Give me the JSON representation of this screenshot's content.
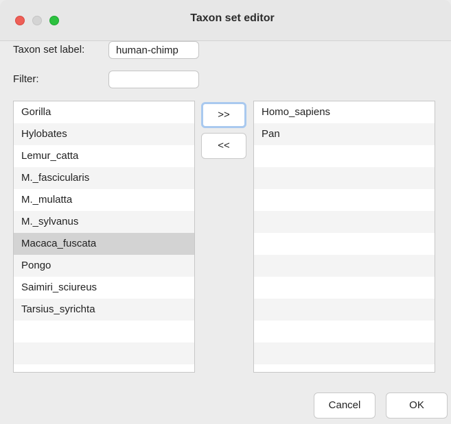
{
  "window": {
    "title": "Taxon set editor"
  },
  "form": {
    "taxon_set_label": "Taxon set label:",
    "taxon_set_value": "human-chimp",
    "filter_label": "Filter:",
    "filter_value": ""
  },
  "available_list": {
    "items": [
      "Gorilla",
      "Hylobates",
      "Lemur_catta",
      "M._fascicularis",
      "M._mulatta",
      "M._sylvanus",
      "Macaca_fuscata",
      "Pongo",
      "Saimiri_sciureus",
      "Tarsius_syrichta"
    ],
    "selected": "Macaca_fuscata"
  },
  "included_list": {
    "items": [
      "Homo_sapiens",
      "Pan"
    ]
  },
  "buttons": {
    "add": ">>",
    "remove": "<<",
    "cancel": "Cancel",
    "ok": "OK"
  },
  "colors": {
    "close": "#ee5f57",
    "minimize": "#d4d4d4",
    "maximize": "#2cc13f",
    "focus_ring": "#a9c9ef",
    "selected_row": "#d3d3d3"
  }
}
